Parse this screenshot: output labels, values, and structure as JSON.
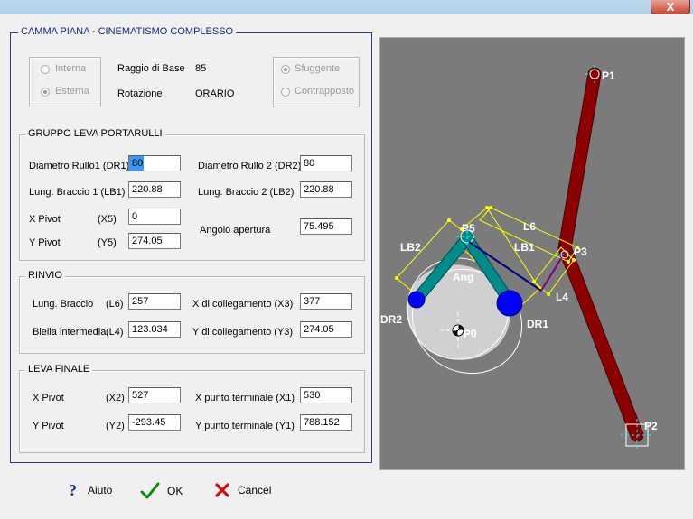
{
  "window": {
    "close_glyph": "X"
  },
  "main": {
    "title": "CAMMA PIANA - CINEMATISMO COMPLESSO",
    "cam_side": {
      "options": [
        "Interna",
        "Esterna"
      ],
      "selected": "Esterna"
    },
    "base_radius_label": "Raggio di Base",
    "base_radius_value": "85",
    "rotation_label": "Rotazione",
    "rotation_value": "ORARIO",
    "follower_mode": {
      "options": [
        "Sfuggente",
        "Contrapposto"
      ],
      "selected": "Sfuggente"
    }
  },
  "roller_group": {
    "title": "GRUPPO LEVA PORTARULLI",
    "dr1_label": "Diametro Rullo1 (DR1)",
    "dr1_value": "80",
    "dr2_label": "Diametro Rullo 2 (DR2)",
    "dr2_value": "80",
    "lb1_label": "Lung. Braccio 1 (LB1)",
    "lb1_value": "220.88",
    "lb2_label": "Lung. Braccio 2 (LB2)",
    "lb2_value": "220.88",
    "x5_label": "X Pivot",
    "x5_code": "(X5)",
    "x5_value": "0",
    "y5_label": "Y Pivot",
    "y5_code": "(Y5)",
    "y5_value": "274.05",
    "angle_label": "Angolo apertura",
    "angle_value": "75.495"
  },
  "rinvio": {
    "title": "RINVIO",
    "l6_label": "Lung. Braccio",
    "l6_code": "(L6)",
    "l6_value": "257",
    "l4_label": "Biella intermedia",
    "l4_code": "(L4)",
    "l4_value": "123.034",
    "x3_label": "X di collegamento (X3)",
    "x3_value": "377",
    "y3_label": "Y di collegamento (Y3)",
    "y3_value": "274.05"
  },
  "final_lever": {
    "title": "LEVA FINALE",
    "x2_label": "X Pivot",
    "x2_code": "(X2)",
    "x2_value": "527",
    "y2_label": "Y Pivot",
    "y2_code": "(Y2)",
    "y2_value": "-293.45",
    "x1_label": "X punto terminale (X1)",
    "x1_value": "530",
    "y1_label": "Y punto terminale (Y1)",
    "y1_value": "788.152"
  },
  "drawing": {
    "labels": {
      "p0": "P0",
      "p1": "P1",
      "p2": "P2",
      "p3": "P3",
      "p5": "P5",
      "lb1": "LB1",
      "lb2": "LB2",
      "l4": "L4",
      "l6": "L6",
      "ang": "Ang",
      "dr1": "DR1",
      "dr2": "DR2"
    },
    "colors": {
      "background": "#7b7b7b",
      "lever": "#8b0000",
      "roller_arm": "#008b8b",
      "roller": "#0000ff",
      "dimension": "#ffff00",
      "cam": "#ffffff",
      "link": "#000080"
    }
  },
  "buttons": {
    "help": "Aiuto",
    "ok": "OK",
    "cancel": "Cancel"
  }
}
